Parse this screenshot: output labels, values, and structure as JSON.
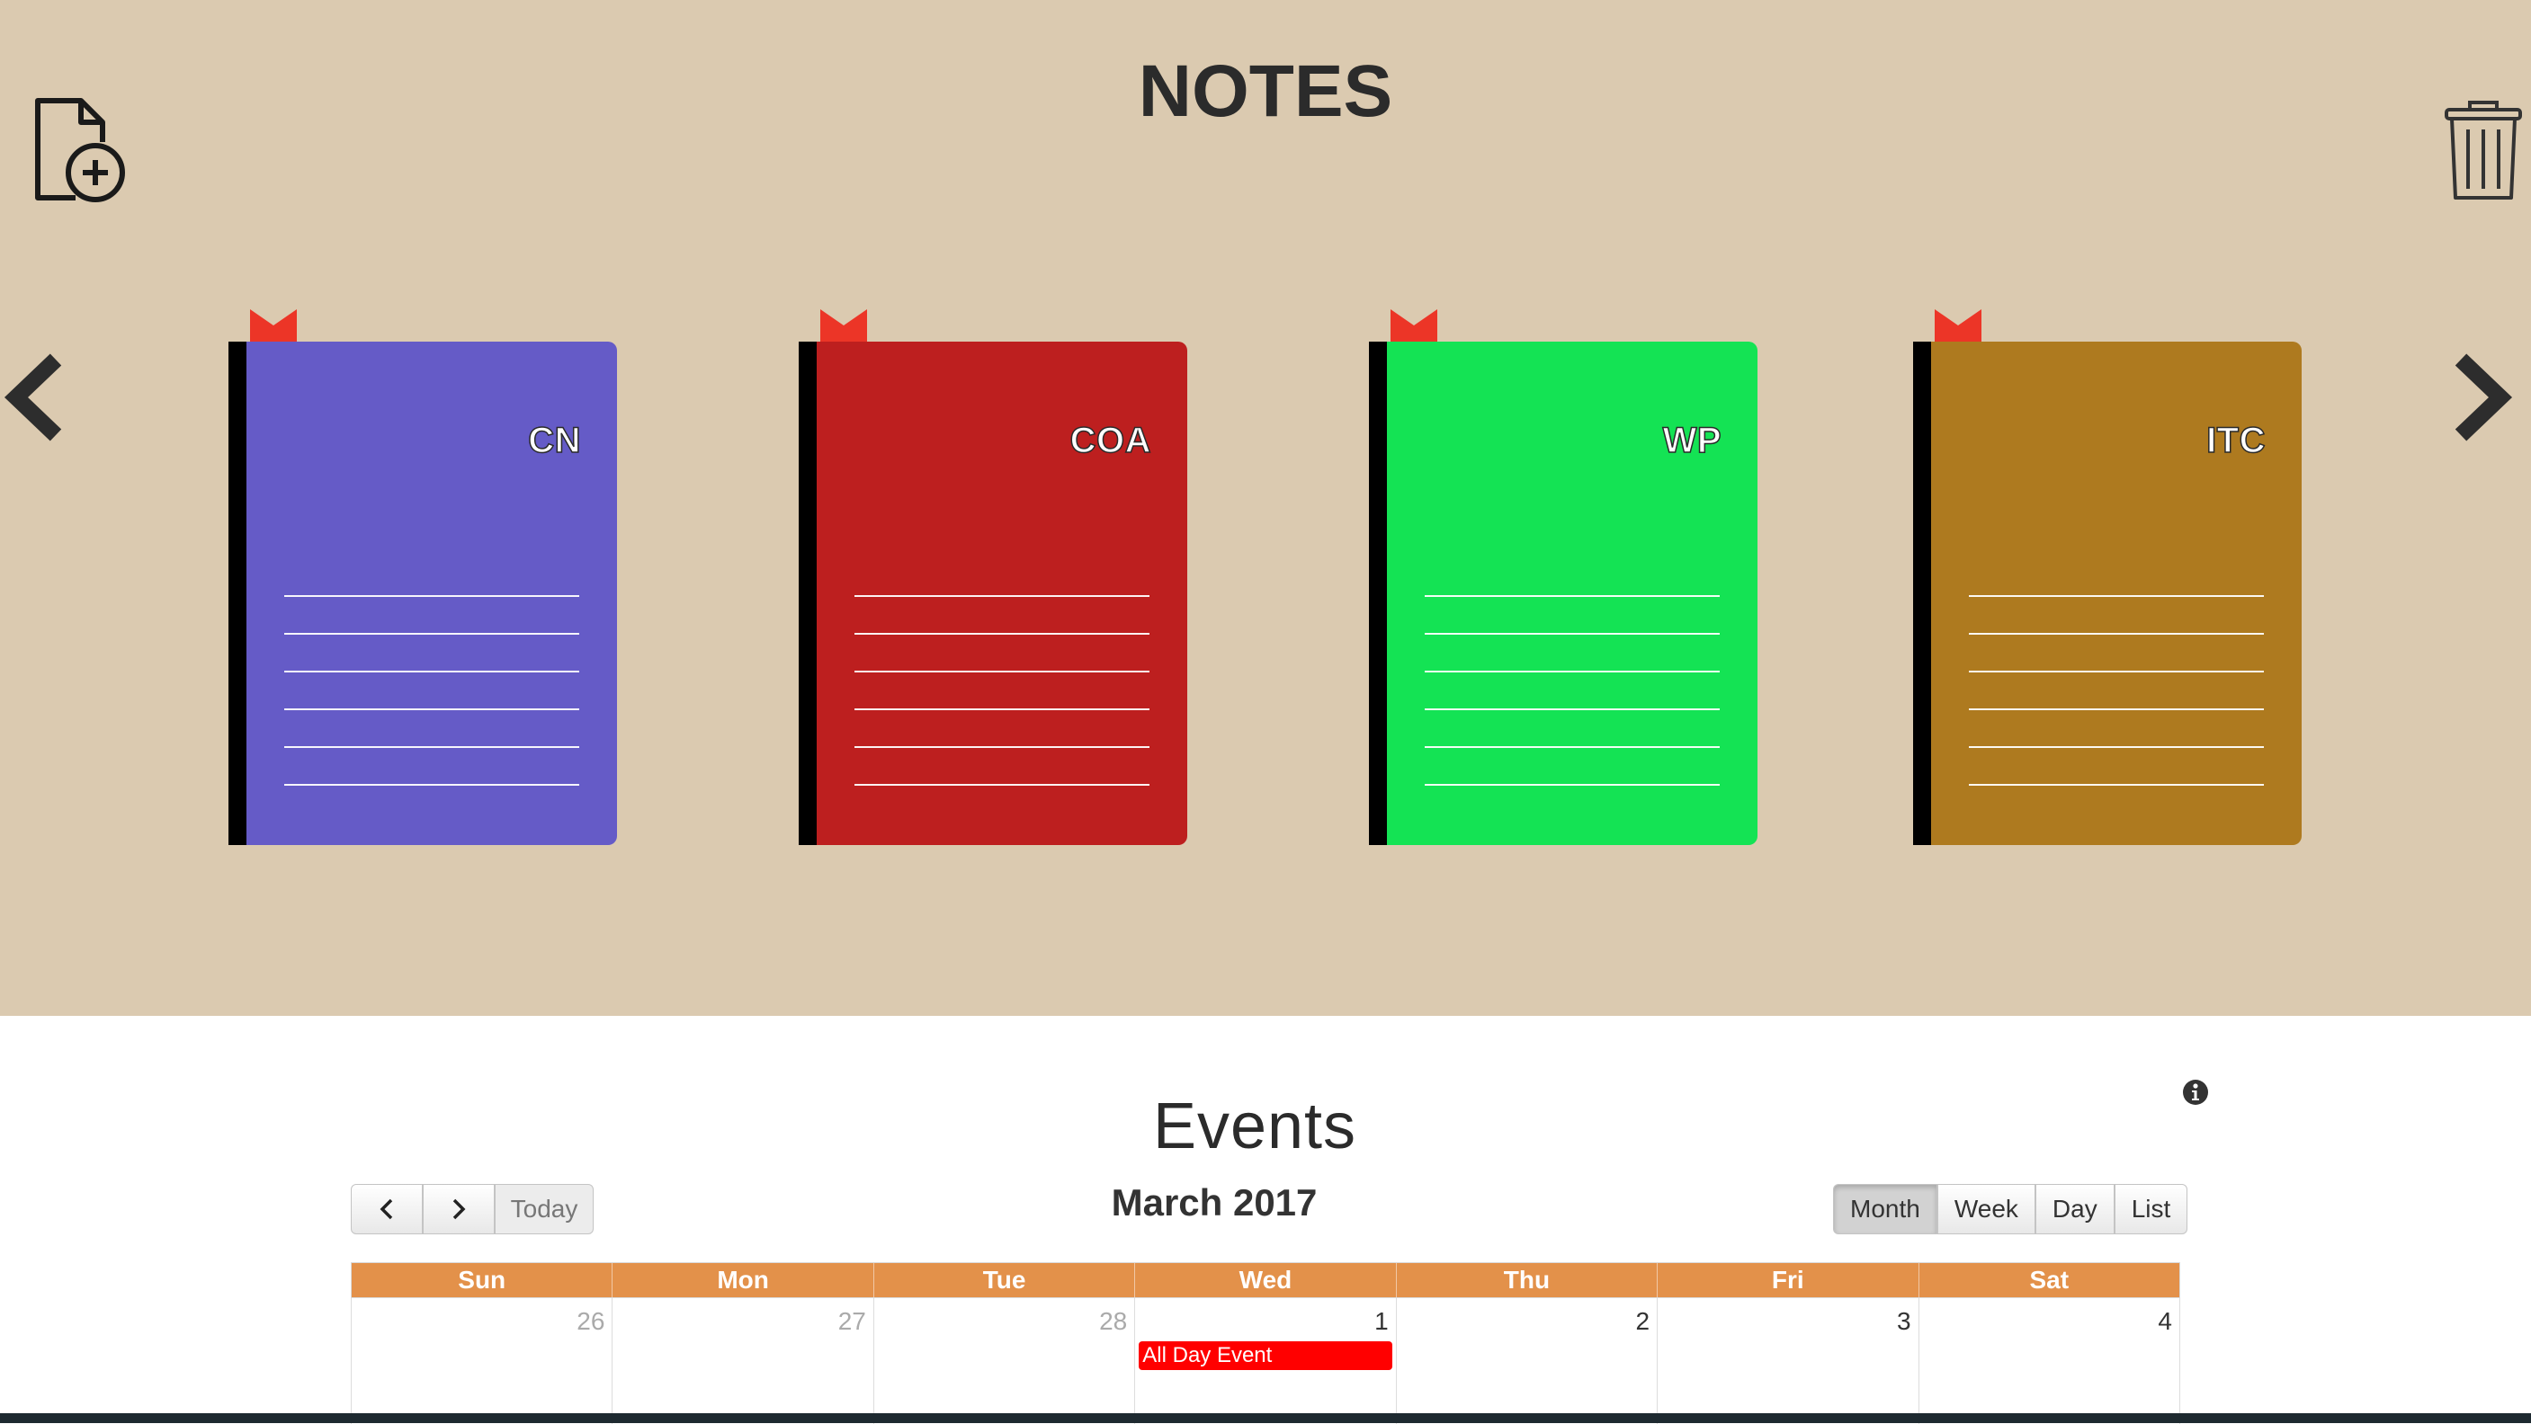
{
  "header": {
    "title": "NOTES"
  },
  "icons": {
    "new_note": "file-plus-icon",
    "trash": "trash-icon",
    "prev": "chevron-left-icon",
    "next": "chevron-right-icon",
    "info": "info-icon"
  },
  "notebooks": [
    {
      "label": "CN",
      "color": "#655bc7"
    },
    {
      "label": "COA",
      "color": "#bd1f1f"
    },
    {
      "label": "WP",
      "color": "#14e354"
    },
    {
      "label": "ITC",
      "color": "#ae7a1f"
    }
  ],
  "ribbon_color": "#ec3527",
  "events": {
    "title": "Events",
    "month_title": "March 2017",
    "today_label": "Today",
    "views": [
      "Month",
      "Week",
      "Day",
      "List"
    ],
    "active_view": "Month",
    "weekdays": [
      "Sun",
      "Mon",
      "Tue",
      "Wed",
      "Thu",
      "Fri",
      "Sat"
    ],
    "days": [
      {
        "num": "26",
        "other": true
      },
      {
        "num": "27",
        "other": true
      },
      {
        "num": "28",
        "other": true
      },
      {
        "num": "1",
        "event": "All Day Event"
      },
      {
        "num": "2"
      },
      {
        "num": "3"
      },
      {
        "num": "4"
      }
    ],
    "header_color": "#e3914a",
    "event_color": "#ff0000"
  }
}
